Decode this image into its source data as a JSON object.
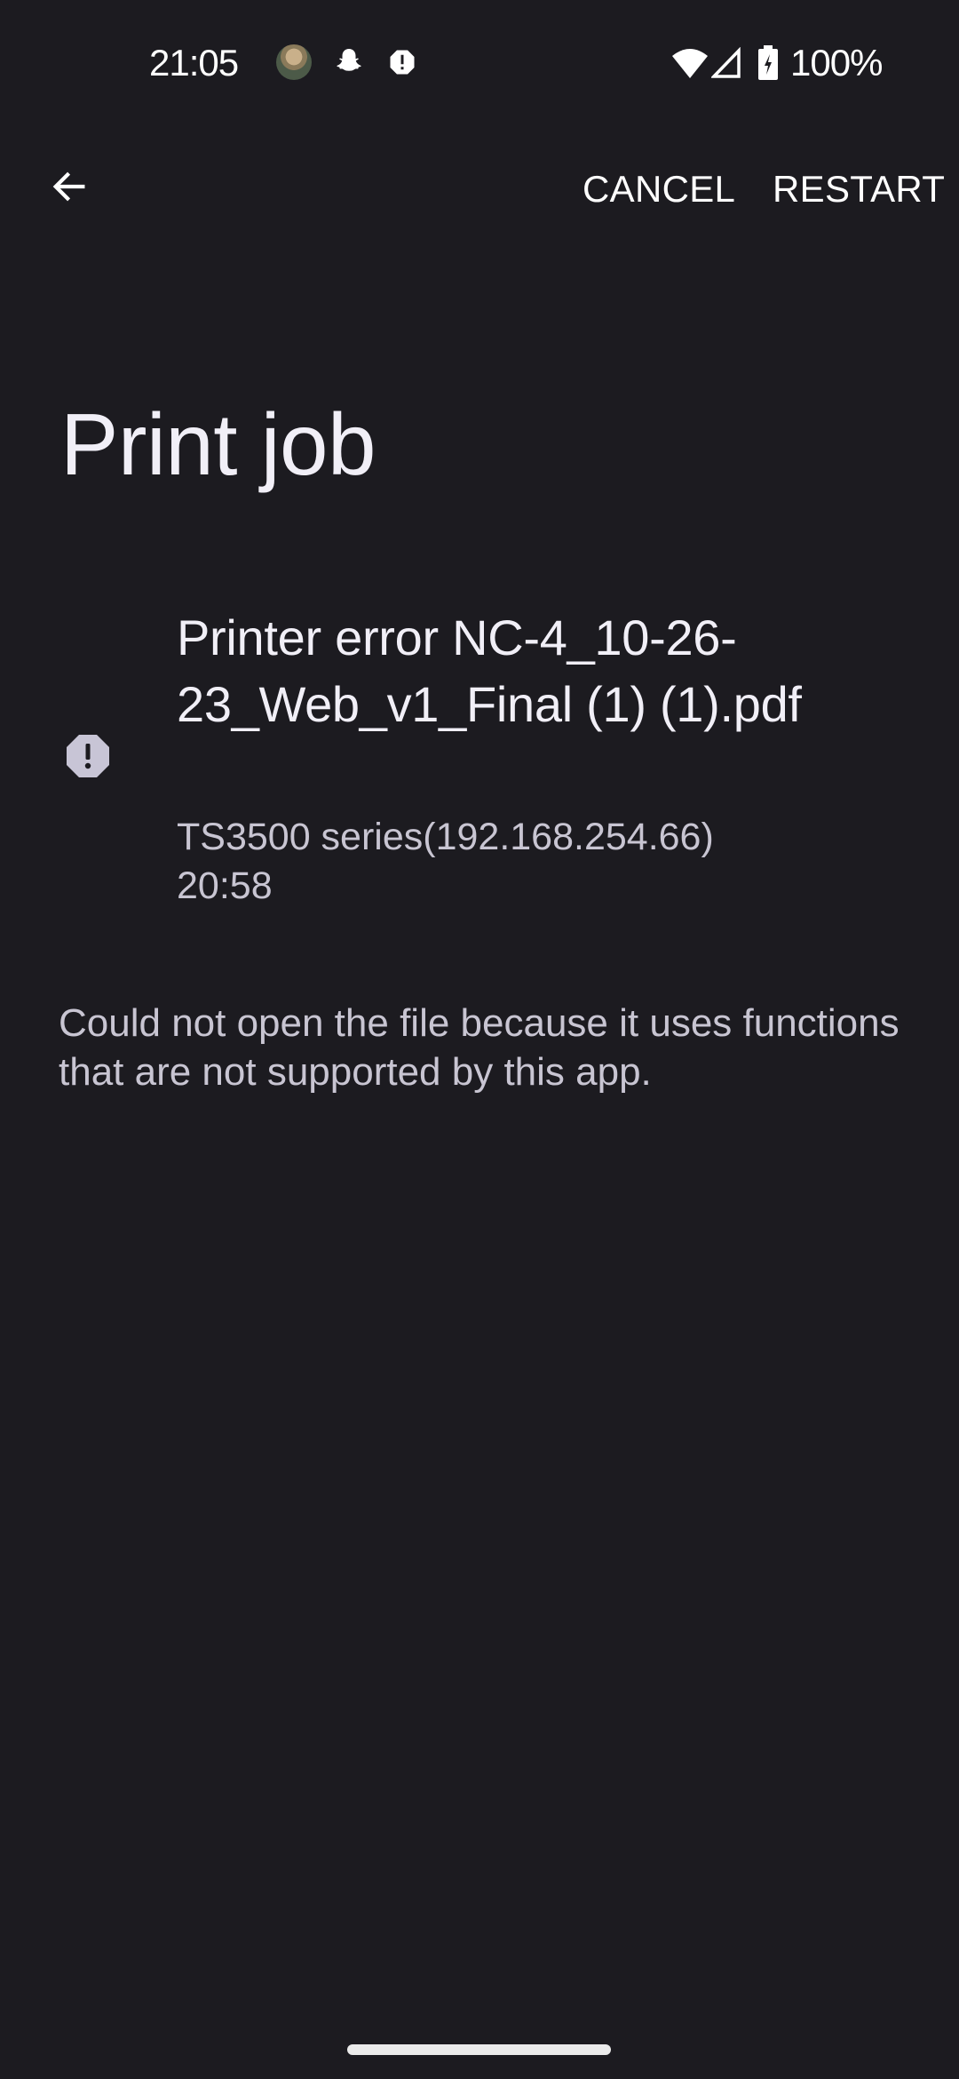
{
  "status_bar": {
    "time": "21:05",
    "notification_icons": [
      "contact-avatar",
      "snapchat-icon",
      "alert-icon"
    ],
    "system_icons": [
      "wifi-icon",
      "cell-signal-icon",
      "battery-charging-icon"
    ],
    "battery_percent": "100%"
  },
  "toolbar": {
    "back_icon": "arrow-back-icon",
    "cancel_label": "CANCEL",
    "restart_label": "RESTART"
  },
  "page": {
    "title": "Print job"
  },
  "job": {
    "status_icon": "error-octagon-icon",
    "title": "Printer error NC-4_10-26-23_Web_v1_Final (1) (1).pdf",
    "printer": "TS3500 series(192.168.254.66)",
    "time": "20:58",
    "message": "Could not open the file because it uses functions that are not supported by this app."
  },
  "colors": {
    "background": "#1c1b20",
    "primary_text": "#f1eff7",
    "secondary_text": "#c8c5d2",
    "icon": "#c8c5d6"
  }
}
